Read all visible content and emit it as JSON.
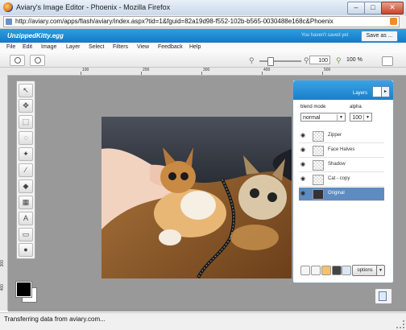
{
  "window": {
    "title": "Aviary's Image Editor - Phoenix - Mozilla Firefox",
    "minimize": "–",
    "maximize": "□",
    "close": "✕"
  },
  "address_bar": {
    "url": "http://aviary.com/apps/flash/aviary/index.aspx?tid=1&fguid=82a19d98-f552-102b-b565-0030488e168c&Phoenix"
  },
  "app_header": {
    "file_name": "UnzippedKitty.egg",
    "save_status": "You haven't saved yet",
    "save_as_label": "Save as ..."
  },
  "menu": [
    "File",
    "Edit",
    "Image",
    "Layer",
    "Select",
    "Filters",
    "View",
    "Feedback",
    "Help"
  ],
  "tool_options": {
    "zoom_value": "100",
    "zoom_percent": "100 %"
  },
  "ruler": {
    "top_labels": [
      "100",
      "200",
      "300",
      "400",
      "500"
    ],
    "left_labels": [
      "300",
      "400"
    ]
  },
  "tools": [
    {
      "name": "select-arrow",
      "glyph": "↖"
    },
    {
      "name": "move",
      "glyph": "✥"
    },
    {
      "name": "marquee",
      "glyph": "⬚"
    },
    {
      "name": "lasso",
      "glyph": "◌"
    },
    {
      "name": "magic-wand",
      "glyph": "✦"
    },
    {
      "name": "brush",
      "glyph": "∕"
    },
    {
      "name": "paint-bucket",
      "glyph": "◆"
    },
    {
      "name": "gradient",
      "glyph": "▦"
    },
    {
      "name": "text",
      "glyph": "A"
    },
    {
      "name": "eraser",
      "glyph": "▭"
    },
    {
      "name": "stamp",
      "glyph": "●"
    }
  ],
  "colors": {
    "foreground": "#000000",
    "background": "#ffffff",
    "accent": "#1a86d4"
  },
  "layers_panel": {
    "title": "Layers",
    "blend_mode_label": "blend mode",
    "blend_mode_value": "normal",
    "alpha_label": "alpha",
    "alpha_value": "100",
    "layers": [
      {
        "name": "Zipper",
        "selected": false
      },
      {
        "name": "Face Halves",
        "selected": false
      },
      {
        "name": "Shadow",
        "selected": false
      },
      {
        "name": "Cat - copy",
        "selected": false
      },
      {
        "name": "Original",
        "selected": true
      }
    ],
    "options_label": "options"
  },
  "status_bar": {
    "text": "Transferring data from aviary.com..."
  }
}
